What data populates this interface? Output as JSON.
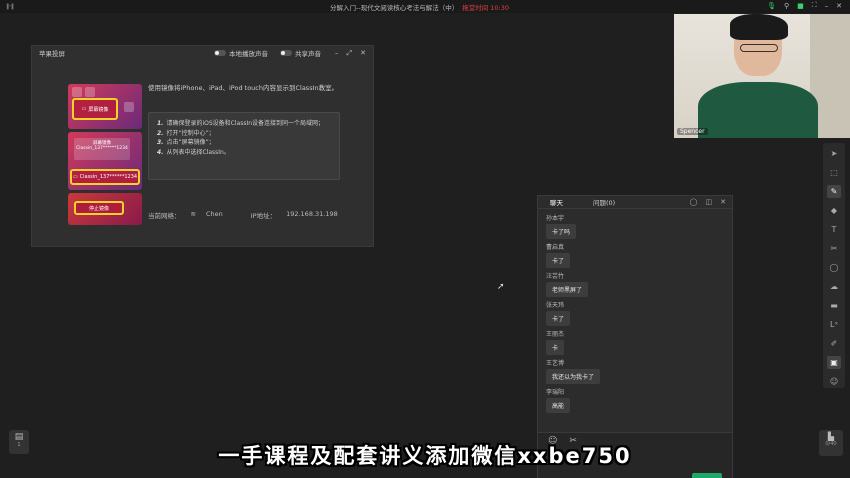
{
  "topbar": {
    "signal": "∥·∥",
    "title": "分解入门--现代文阅读核心考法与解法（中）",
    "timer": "拖堂时间 10:30"
  },
  "cast_window": {
    "title": "苹果投屏",
    "local_sound_label": "本地播放声音",
    "share_sound_label": "共享声音",
    "intro": "使用镜像将iPhone、iPad、iPod touch内容显示到ClassIn教室。",
    "steps": [
      {
        "num": "1.",
        "text": "请确保登录的iOS设备和ClassIn设备连接到同一个局域网；"
      },
      {
        "num": "2.",
        "text": "打开“控制中心”；"
      },
      {
        "num": "3.",
        "text": "点击“屏幕镜像”；"
      },
      {
        "num": "4.",
        "text": "从列表中选择ClassIn。"
      }
    ],
    "phone": {
      "mirror_label": "屏幕镜像",
      "mirror_title": "屏幕镜像",
      "device_small": "Classin_137******1234",
      "device": "Classin_137******1234",
      "stop_label": "停止镜像"
    },
    "network_label": "当前网络：",
    "network_name": "Chen",
    "ip_label": "IP地址：",
    "ip_value": "192.168.31.198"
  },
  "webcam": {
    "name": "Spencer"
  },
  "chat": {
    "tabs": [
      "聊天",
      "问题(0)"
    ],
    "messages": [
      {
        "user": "孙本宇",
        "text": "卡了吗"
      },
      {
        "user": "曹启真",
        "text": "卡了"
      },
      {
        "user": "汪芸竹",
        "text": "老师黑屏了"
      },
      {
        "user": "张天玮",
        "text": "卡了"
      },
      {
        "user": "王丽杰",
        "text": "卡"
      },
      {
        "user": "王艺博",
        "text": "我还以为我卡了"
      },
      {
        "user": "李瑞阳",
        "text": "高能"
      }
    ]
  },
  "bottom": {
    "doc_count": "1",
    "page_count": "0/40"
  },
  "caption": "一手课程及配套讲义添加微信xxbe750"
}
